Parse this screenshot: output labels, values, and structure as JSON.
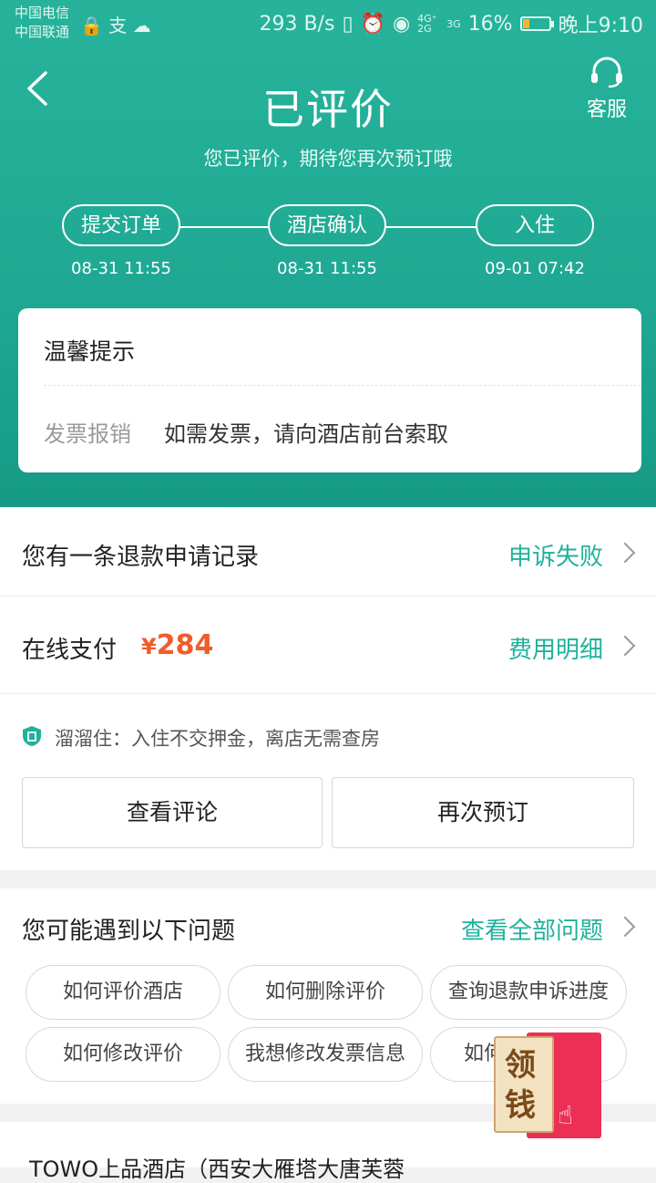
{
  "status_bar": {
    "carrier_1": "中国电信",
    "carrier_2": "中国联通",
    "speed": "293 B/s",
    "network_1": "4G⁺ 2G",
    "network_2": "3G",
    "battery": "16%",
    "time": "晚上9:10"
  },
  "header": {
    "title": "已评价",
    "service_label": "客服",
    "subtitle": "您已评价，期待您再次预订哦"
  },
  "progress": {
    "steps": [
      {
        "label": "提交订单",
        "time": "08-31 11:55"
      },
      {
        "label": "酒店确认",
        "time": "08-31 11:55"
      },
      {
        "label": "入住",
        "time": "09-01 07:42"
      }
    ]
  },
  "tips": {
    "title": "温馨提示",
    "key": "发票报销",
    "value": "如需发票，请向酒店前台索取"
  },
  "refund": {
    "label": "您有一条退款申请记录",
    "status": "申诉失败"
  },
  "payment": {
    "label": "在线支付",
    "currency": "¥",
    "amount": "284",
    "detail": "费用明细"
  },
  "deposit": {
    "text": "溜溜住：入住不交押金，离店无需查房"
  },
  "actions": {
    "view_review": "查看评论",
    "book_again": "再次预订"
  },
  "faq": {
    "title": "您可能遇到以下问题",
    "view_all": "查看全部问题",
    "chips": [
      "如何评价酒店",
      "如何删除评价",
      "查询退款申诉进度",
      "如何修改评价",
      "我想修改发票信息",
      "如何"
    ]
  },
  "hotel": {
    "name": "TOWO上品酒店（西安大雁塔大唐芙蓉"
  },
  "red_packet": {
    "text": "领钱"
  },
  "colors": {
    "teal": "#1fa994",
    "link": "#1fb29b",
    "price": "#f25c2a",
    "red_packet": "#ec2f55"
  }
}
